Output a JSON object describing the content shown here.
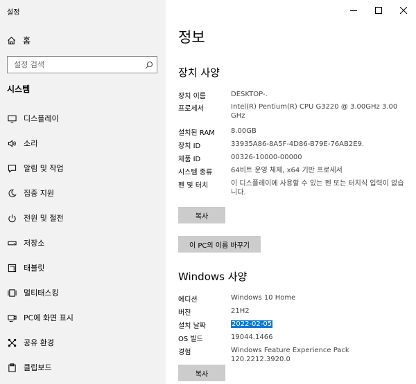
{
  "app": {
    "title": "설정"
  },
  "sidebar": {
    "home_label": "홈",
    "search_placeholder": "설정 검색",
    "section_title": "시스템",
    "items": [
      {
        "label": "디스플레이",
        "icon": "monitor-icon"
      },
      {
        "label": "소리",
        "icon": "speaker-icon"
      },
      {
        "label": "알림 및 작업",
        "icon": "notification-icon"
      },
      {
        "label": "집중 지원",
        "icon": "moon-icon"
      },
      {
        "label": "전원 및 절전",
        "icon": "power-icon"
      },
      {
        "label": "저장소",
        "icon": "storage-icon"
      },
      {
        "label": "태블릿",
        "icon": "tablet-icon"
      },
      {
        "label": "멀티태스킹",
        "icon": "multitasking-icon"
      },
      {
        "label": "PC에 화면 표시",
        "icon": "projector-icon"
      },
      {
        "label": "공유 환경",
        "icon": "shared-icon"
      },
      {
        "label": "클립보드",
        "icon": "clipboard-icon"
      }
    ]
  },
  "main": {
    "title": "정보",
    "device_specs": {
      "heading": "장치 사양",
      "rows": [
        {
          "key": "장치 이름",
          "value": "DESKTOP-."
        },
        {
          "key": "프로세서",
          "value": "Intel(R) Pentium(R) CPU G3220 @ 3.00GHz   3.00 GHz"
        },
        {
          "key": "설치된 RAM",
          "value": "8.00GB"
        },
        {
          "key": "장치 ID",
          "value": "33935A86-8A5F-4D86-B79E-76AB2E9."
        },
        {
          "key": "제품 ID",
          "value": "00326-10000-00000"
        },
        {
          "key": "시스템 종류",
          "value": "64비트 운영 체제, x64 기반 프로세서"
        },
        {
          "key": "펜 및 터치",
          "value": "이 디스플레이에 사용할 수 있는 펜 또는 터치식 입력이 없습니다."
        }
      ],
      "copy_label": "복사",
      "rename_label": "이 PC의 이름 바꾸기"
    },
    "windows_specs": {
      "heading": "Windows 사양",
      "rows": [
        {
          "key": "에디션",
          "value": "Windows 10 Home"
        },
        {
          "key": "버전",
          "value": "21H2"
        },
        {
          "key": "설치 날짜",
          "value": "2022-02-05"
        },
        {
          "key": "OS 빌드",
          "value": "19044.1466"
        },
        {
          "key": "경험",
          "value": "Windows Feature Experience Pack 120.2212.3920.0"
        }
      ],
      "copy_label": "복사"
    }
  }
}
